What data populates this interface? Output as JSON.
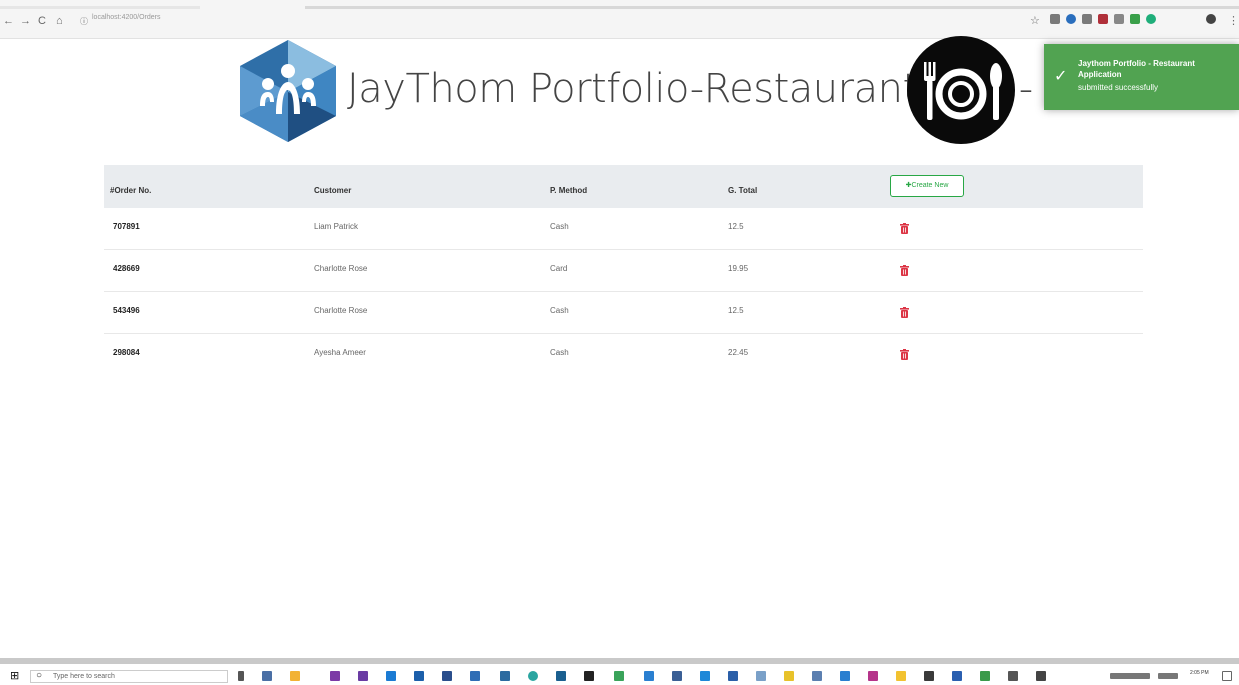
{
  "browser": {
    "url": "localhost:4200/Orders",
    "nav_back": "←",
    "nav_forward": "→",
    "nav_reload": "C",
    "nav_home": "⌂"
  },
  "header": {
    "title": "JayThom Portfolio-Restaurant App -"
  },
  "toast": {
    "title": "Jaythom Portfolio - Restaurant Application",
    "message": "submitted successfully",
    "color": "#51a351"
  },
  "orders": {
    "columns": [
      "#Order No.",
      "Customer",
      "P. Method",
      "G. Total"
    ],
    "create_label": "✚Create New",
    "rows": [
      {
        "order_no": "707891",
        "customer": "Liam Patrick",
        "method": "Cash",
        "total": "12.5"
      },
      {
        "order_no": "428669",
        "customer": "Charlotte Rose",
        "method": "Card",
        "total": "19.95"
      },
      {
        "order_no": "543496",
        "customer": "Charlotte Rose",
        "method": "Cash",
        "total": "12.5"
      },
      {
        "order_no": "298084",
        "customer": "Ayesha Ameer",
        "method": "Cash",
        "total": "22.45"
      }
    ],
    "delete_color": "#dc3545"
  },
  "taskbar": {
    "search_placeholder": "Type here to search",
    "time": "2:05 PM"
  }
}
